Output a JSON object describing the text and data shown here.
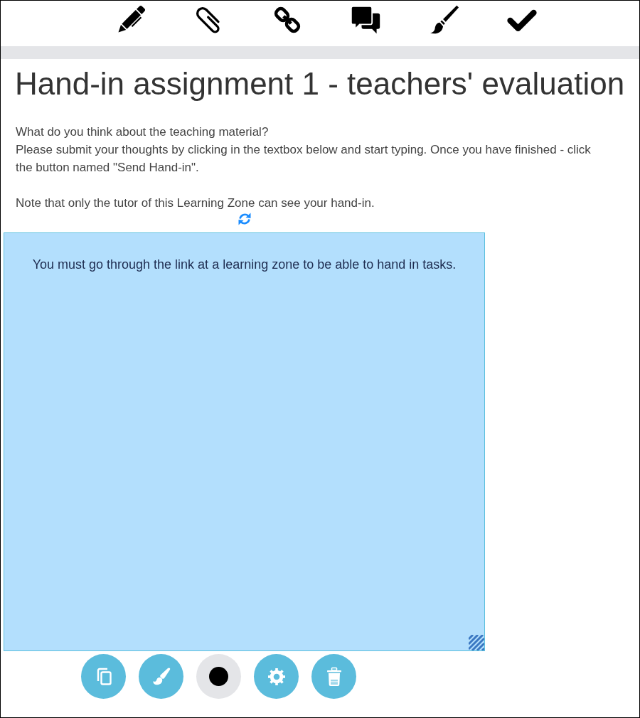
{
  "page": {
    "title": "Hand-in assignment 1 - teachers' evaluation"
  },
  "instructions": {
    "question": "What do you think about the teaching material?",
    "prompt": "Please submit your thoughts by clicking in the textbox below and start typing. Once you have finished - click the button named \"Send Hand-in\".",
    "note": "Note that only the tutor of this Learning Zone can see your hand-in."
  },
  "editor": {
    "message": "You must go through the link at a learning zone to be able to hand in tasks."
  },
  "color_picker": {
    "color": "#000000"
  }
}
